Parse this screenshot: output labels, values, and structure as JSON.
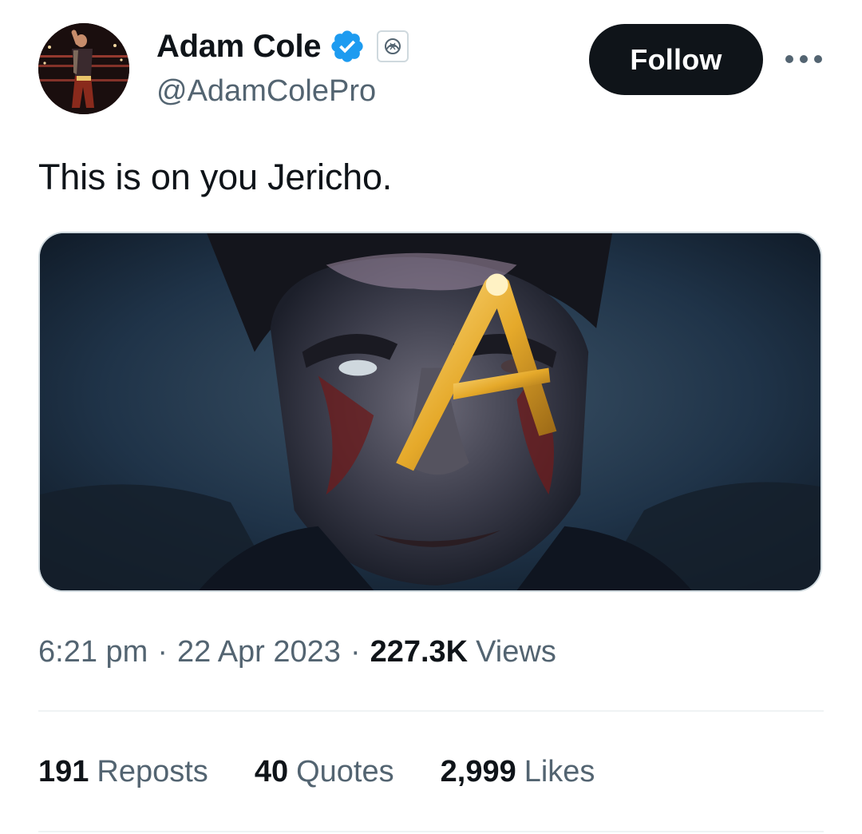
{
  "user": {
    "display_name": "Adam Cole",
    "handle": "@AdamColePro",
    "verified": true,
    "avatar_icon": "wrestler-avatar-photo",
    "affiliate_icon": "affiliate-badge-icon"
  },
  "actions": {
    "follow_label": "Follow",
    "more_icon": "more-options-icon"
  },
  "tweet": {
    "text": "This is on you Jericho.",
    "media_description_icon": "painted-portrait-image"
  },
  "meta": {
    "time": "6:21 pm",
    "separator": "·",
    "date": "22 Apr 2023",
    "views_count": "227.3K",
    "views_label": "Views"
  },
  "stats": {
    "reposts_count": "191",
    "reposts_label": "Reposts",
    "quotes_count": "40",
    "quotes_label": "Quotes",
    "likes_count": "2,999",
    "likes_label": "Likes"
  },
  "colors": {
    "primary_text": "#0f1419",
    "secondary_text": "#536471",
    "verified_blue": "#1d9bf0",
    "follow_bg": "#0f1419",
    "divider": "#eff3f4"
  }
}
